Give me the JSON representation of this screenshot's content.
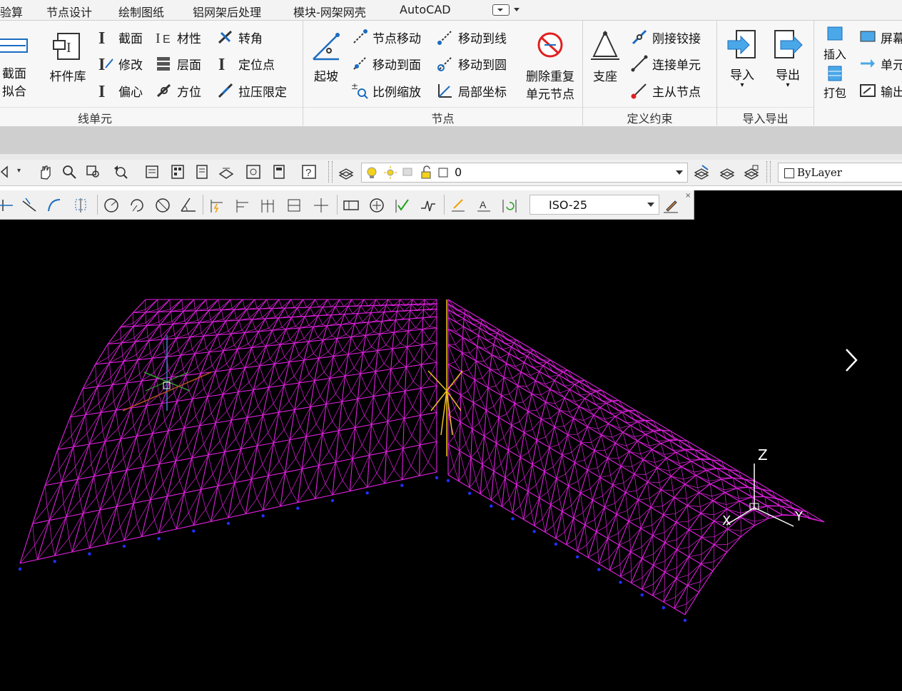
{
  "menu": {
    "items": [
      "验算",
      "节点设计",
      "绘制图纸",
      "铝网架后处理",
      "模块-网架网壳",
      "AutoCAD"
    ]
  },
  "ribbon": {
    "panels": {
      "line_element": {
        "title": "线单元",
        "big": {
          "section_fit_line1": "截面",
          "section_fit_line2": "拟合",
          "member_lib": "杆件库"
        },
        "buttons": [
          "截面",
          "材性",
          "转角",
          "修改",
          "层面",
          "定位点",
          "偏心",
          "方位",
          "拉压限定"
        ]
      },
      "node": {
        "title": "节点",
        "big": {
          "slope": "起坡",
          "delete_dup_line1": "删除重复",
          "delete_dup_line2": "单元节点"
        },
        "buttons": [
          "节点移动",
          "移动到线",
          "移动到面",
          "移动到圆",
          "比例缩放",
          "局部坐标"
        ]
      },
      "constraint": {
        "title": "定义约束",
        "big": {
          "support": "支座"
        },
        "buttons": [
          "刚接铰接",
          "连接单元",
          "主从节点"
        ]
      },
      "io": {
        "title": "导入导出",
        "big": {
          "import": "导入",
          "export": "导出"
        }
      },
      "misc": {
        "insert": "插入",
        "pack": "打包",
        "screen": "屏幕",
        "unit": "单元",
        "output": "输出"
      }
    }
  },
  "layer_toolbar": {
    "current_layer": "0",
    "linetype": "ByLayer"
  },
  "dim_toolbar": {
    "dim_style": "ISO-25"
  },
  "viewport": {
    "ucs": {
      "z": "Z",
      "x": "X",
      "y": "Y"
    },
    "colors": {
      "background": "#000000",
      "model": "#e020e0",
      "nodes": "#2030ff",
      "yellow": "#f0c020"
    }
  }
}
